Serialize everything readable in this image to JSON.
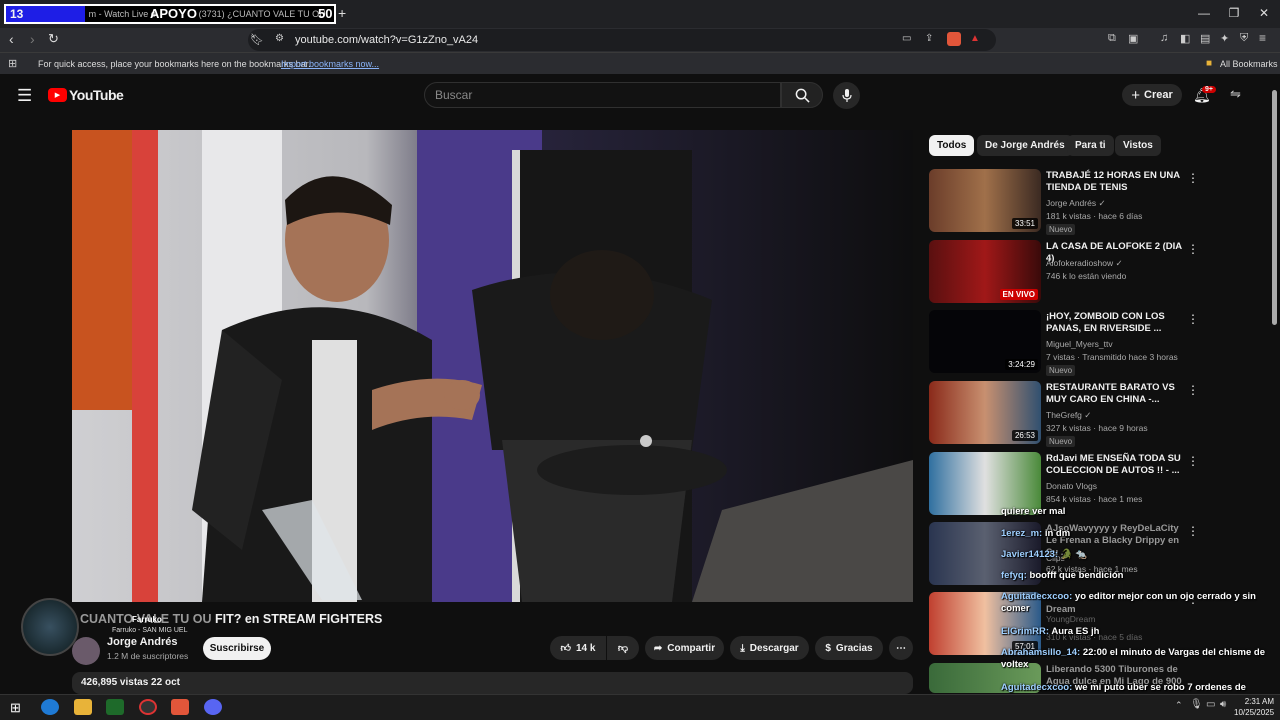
{
  "browser": {
    "tab_counter": "13",
    "tab_text": "m - Watch Live o",
    "apoyo": "APOYO",
    "tab_title2": "(3731) ¿CUANTO VALE TU OU",
    "counter_right": "50",
    "url": "youtube.com/watch?v=G1zZno_vA24",
    "bookmark_hint": "For quick access, place your bookmarks here on the bookmarks bar.",
    "import_link": "Import bookmarks now...",
    "all_bookmarks": "All Bookmarks"
  },
  "youtube": {
    "logo": "YouTube",
    "search_placeholder": "Buscar",
    "create_label": "Crear",
    "notif_badge": "9+",
    "chips": [
      "Todos",
      "De Jorge Andrés",
      "Para ti",
      "Vistos"
    ],
    "recommendations": [
      {
        "title": "TRABAJÉ 12 HORAS EN UNA TIENDA DE TENIS",
        "channel": "Jorge Andrés ✓",
        "meta": "181 k vistas · hace 6 días",
        "badge": "Nuevo",
        "duration": "33:51"
      },
      {
        "title": "LA CASA DE ALOFOKE 2 (DIA 4)",
        "channel": "Alofokeradioshow ✓",
        "meta": "746 k lo están viendo",
        "badge": "",
        "duration": "EN VIVO"
      },
      {
        "title": "¡HOY, ZOMBOID CON LOS PANAS, EN RIVERSIDE ...",
        "channel": "Miguel_Myers_ttv",
        "meta": "7 vistas · Transmitido hace 3 horas",
        "badge": "Nuevo",
        "duration": "3:24:29"
      },
      {
        "title": "RESTAURANTE BARATO VS MUY CARO EN CHINA -...",
        "channel": "TheGrefg ✓",
        "meta": "327 k vistas · hace 9 horas",
        "badge": "Nuevo",
        "duration": "26:53"
      },
      {
        "title": "RdJavi ME ENSEÑA TODA SU COLECCION DE AUTOS !! - ...",
        "channel": "Donato Vlogs",
        "meta": "854 k vistas · hace 1 mes",
        "badge": "",
        "duration": ""
      },
      {
        "title": "AJsoWavyyyy y ReyDeLaCity Le Frenan a Blacky Drippy en Su ...",
        "channel": "Clips",
        "meta": "62 k vistas · hace 1 mes",
        "badge": "",
        "duration": ""
      },
      {
        "title": "Dream",
        "channel": "YoungDream",
        "meta": "310 k vistas · hace 5 días",
        "badge": "",
        "duration": "57:01"
      },
      {
        "title": "Liberando 5300 Tiburones de Agua dulce en Mi Lago de 900 ...",
        "channel": "",
        "meta": "",
        "badge": "",
        "duration": ""
      }
    ],
    "video": {
      "title": "FIT? en STREAM FIGHTERS",
      "overlay_title": "CUANTO VALE TU OU",
      "channel": "Jorge Andrés",
      "subs": "1.2 M de suscriptores",
      "subscribe": "Suscribirse",
      "likes": "14 k",
      "share": "Compartir",
      "download": "Descargar",
      "thanks": "Gracias",
      "views_date": "426,895 vistas  22 oct"
    }
  },
  "chat": [
    {
      "user": "",
      "msg": "quiere ver mal"
    },
    {
      "user": "1erez_m:",
      "msg": "in dm"
    },
    {
      "user": "Javier14123:",
      "msg": "🐊 🐀"
    },
    {
      "user": "fefyq:",
      "msg": "boofff que bendición"
    },
    {
      "user": "Aguitadecxcoo:",
      "msg": "yo editor mejor con un ojo cerrado y sin comer"
    },
    {
      "user": "ElGrimRR:",
      "msg": "Aura ES jh"
    },
    {
      "user": "Abrahamsillo_14:",
      "msg": "22:00 el minuto de Vargas del chisme de voltex"
    },
    {
      "user": "Aguitadecxcoo:",
      "msg": "we mi puto uber se robo 7 ordenes de sushi"
    }
  ],
  "overlay": {
    "farruko": "Farruko",
    "farruko_sub": "Farruko - SAN MIG UEL"
  },
  "taskbar": {
    "time": "2:31 AM",
    "date": "10/25/2025"
  }
}
